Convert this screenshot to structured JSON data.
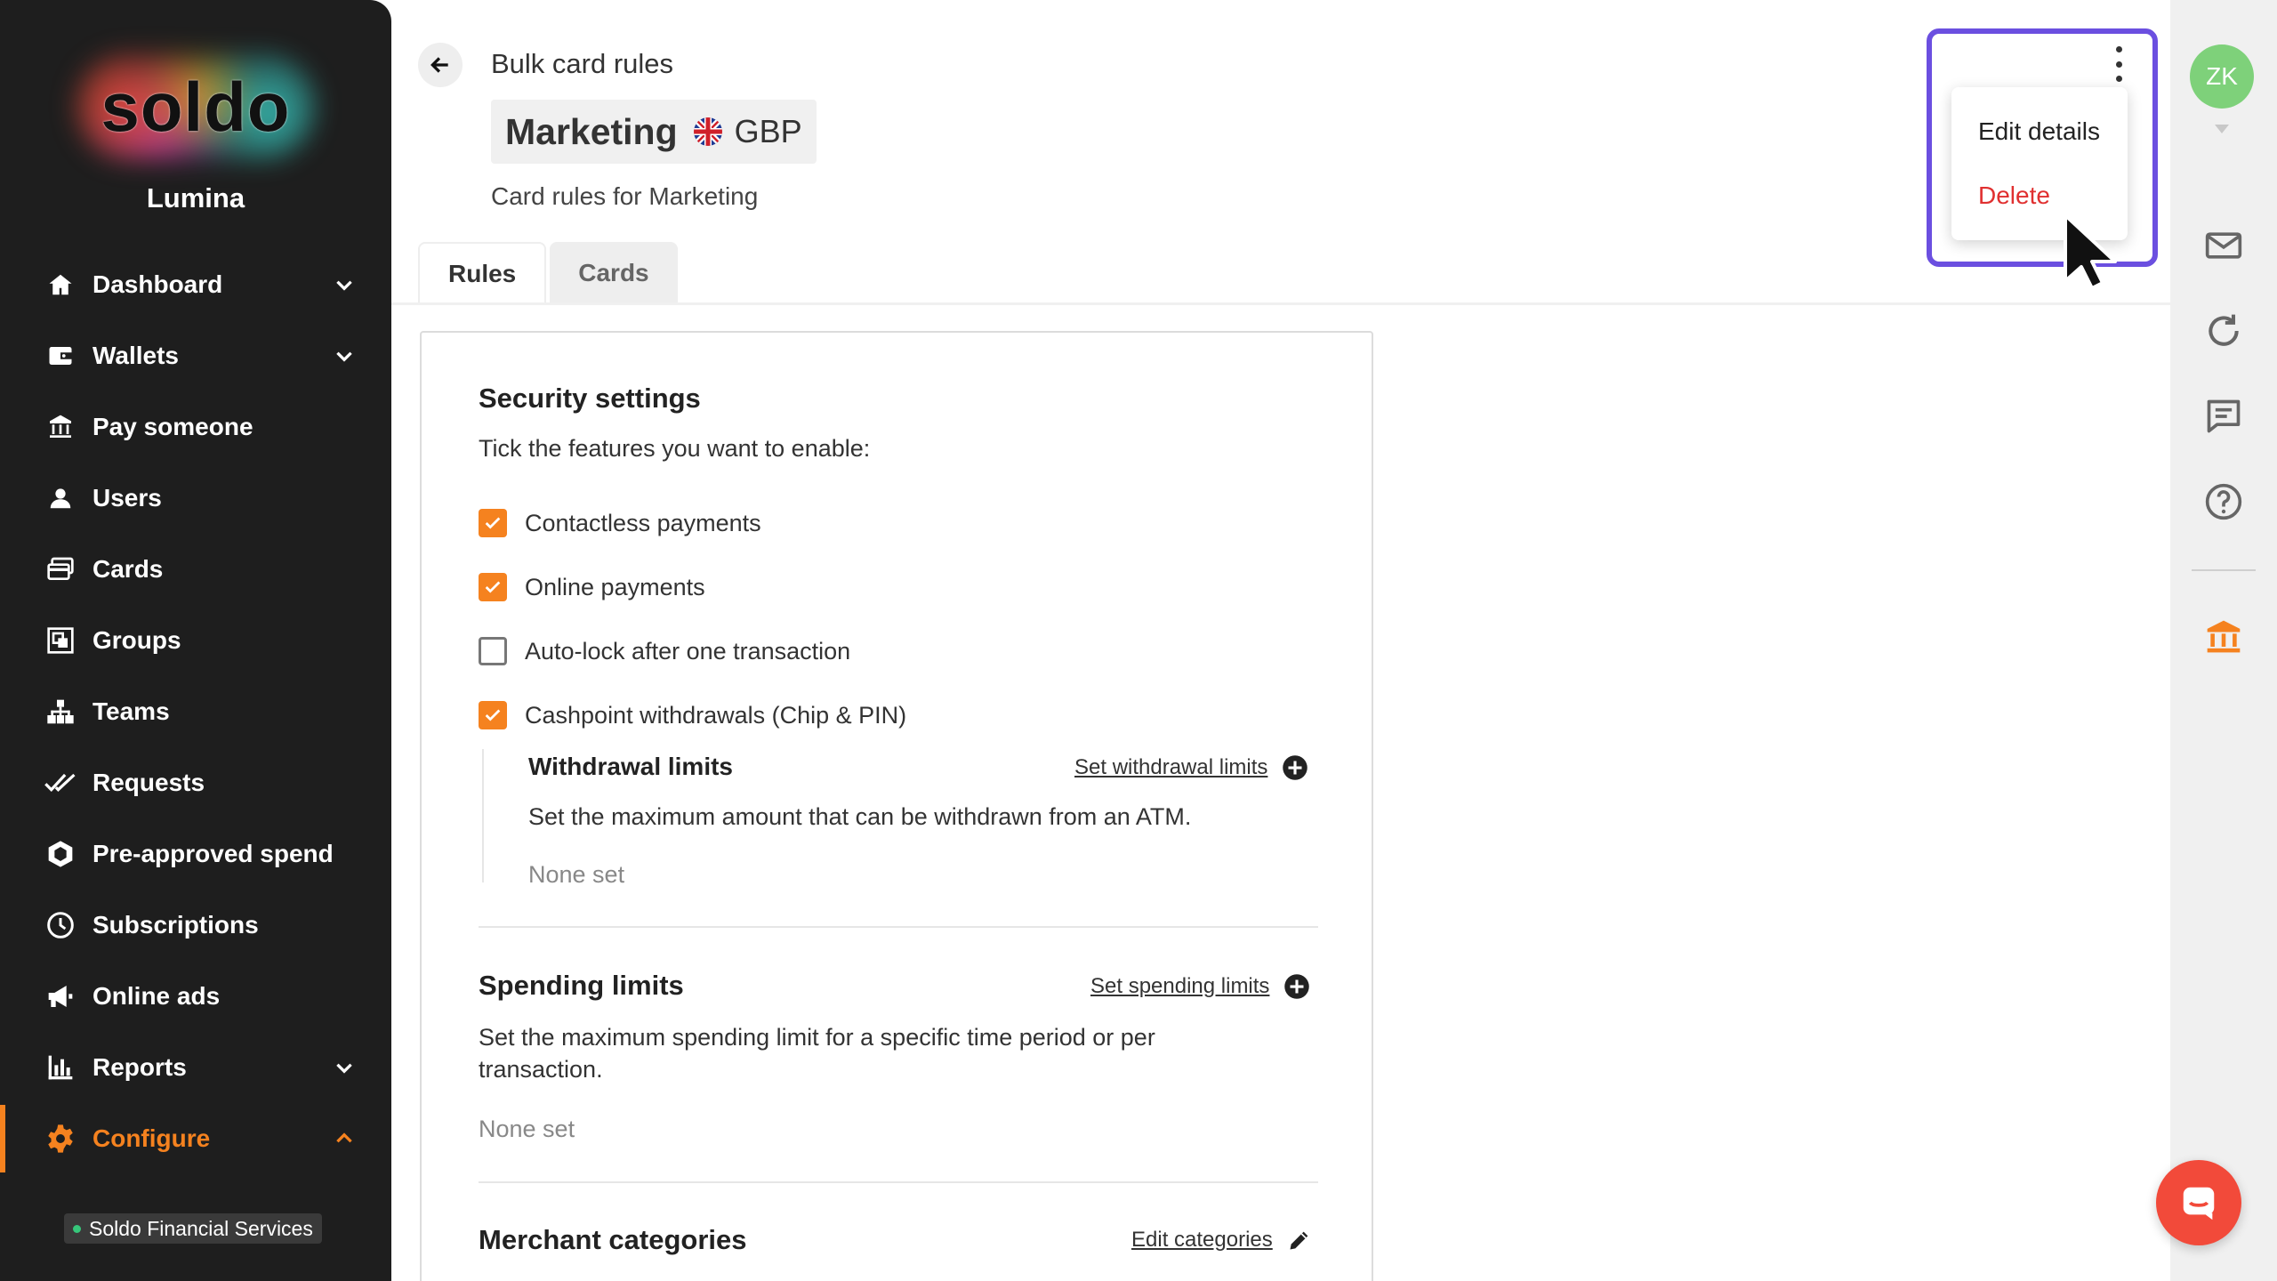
{
  "sidebar": {
    "logo_text": "soldo",
    "org_name": "Lumina",
    "items": [
      {
        "label": "Dashboard",
        "icon": "home-icon",
        "chevron": "down"
      },
      {
        "label": "Wallets",
        "icon": "wallet-icon",
        "chevron": "down"
      },
      {
        "label": "Pay someone",
        "icon": "bank-transfer-icon"
      },
      {
        "label": "Users",
        "icon": "user-icon"
      },
      {
        "label": "Cards",
        "icon": "cards-icon"
      },
      {
        "label": "Groups",
        "icon": "groups-icon"
      },
      {
        "label": "Teams",
        "icon": "teams-icon"
      },
      {
        "label": "Requests",
        "icon": "double-check-icon"
      },
      {
        "label": "Pre-approved spend",
        "icon": "hexagon-icon"
      },
      {
        "label": "Subscriptions",
        "icon": "clock-icon"
      },
      {
        "label": "Online ads",
        "icon": "megaphone-icon"
      },
      {
        "label": "Reports",
        "icon": "bar-chart-icon",
        "chevron": "down"
      },
      {
        "label": "Configure",
        "icon": "gear-icon",
        "chevron": "up",
        "active": true
      }
    ],
    "footer_badge": "Soldo Financial Services"
  },
  "header": {
    "breadcrumb": "Bulk card rules",
    "title": "Marketing",
    "currency": "GBP",
    "subtitle": "Card rules for Marketing"
  },
  "tabs": [
    {
      "label": "Rules",
      "active": true
    },
    {
      "label": "Cards",
      "active": false
    }
  ],
  "security": {
    "title": "Security settings",
    "instruction": "Tick the features you want to enable:",
    "options": [
      {
        "label": "Contactless payments",
        "checked": true
      },
      {
        "label": "Online payments",
        "checked": true
      },
      {
        "label": "Auto-lock after one transaction",
        "checked": false
      },
      {
        "label": "Cashpoint withdrawals (Chip & PIN)",
        "checked": true
      }
    ],
    "withdrawal": {
      "title": "Withdrawal limits",
      "link": "Set withdrawal limits",
      "description": "Set the maximum amount that can be withdrawn from an ATM.",
      "value": "None set"
    }
  },
  "spending": {
    "title": "Spending limits",
    "link": "Set spending limits",
    "description": "Set the maximum spending limit for a specific time period or per transaction.",
    "value": "None set"
  },
  "merchant": {
    "title": "Merchant categories",
    "link": "Edit categories"
  },
  "menu": {
    "items": [
      {
        "label": "Edit details"
      },
      {
        "label": "Delete",
        "danger": true
      }
    ]
  },
  "user": {
    "initials": "ZK"
  },
  "colors": {
    "accent": "#f5821f",
    "sidebar_bg": "#1e1e1e",
    "highlight": "#6b4fe0",
    "danger": "#e03030",
    "avatar": "#7ed17a",
    "chat_fab": "#f24a3a"
  }
}
